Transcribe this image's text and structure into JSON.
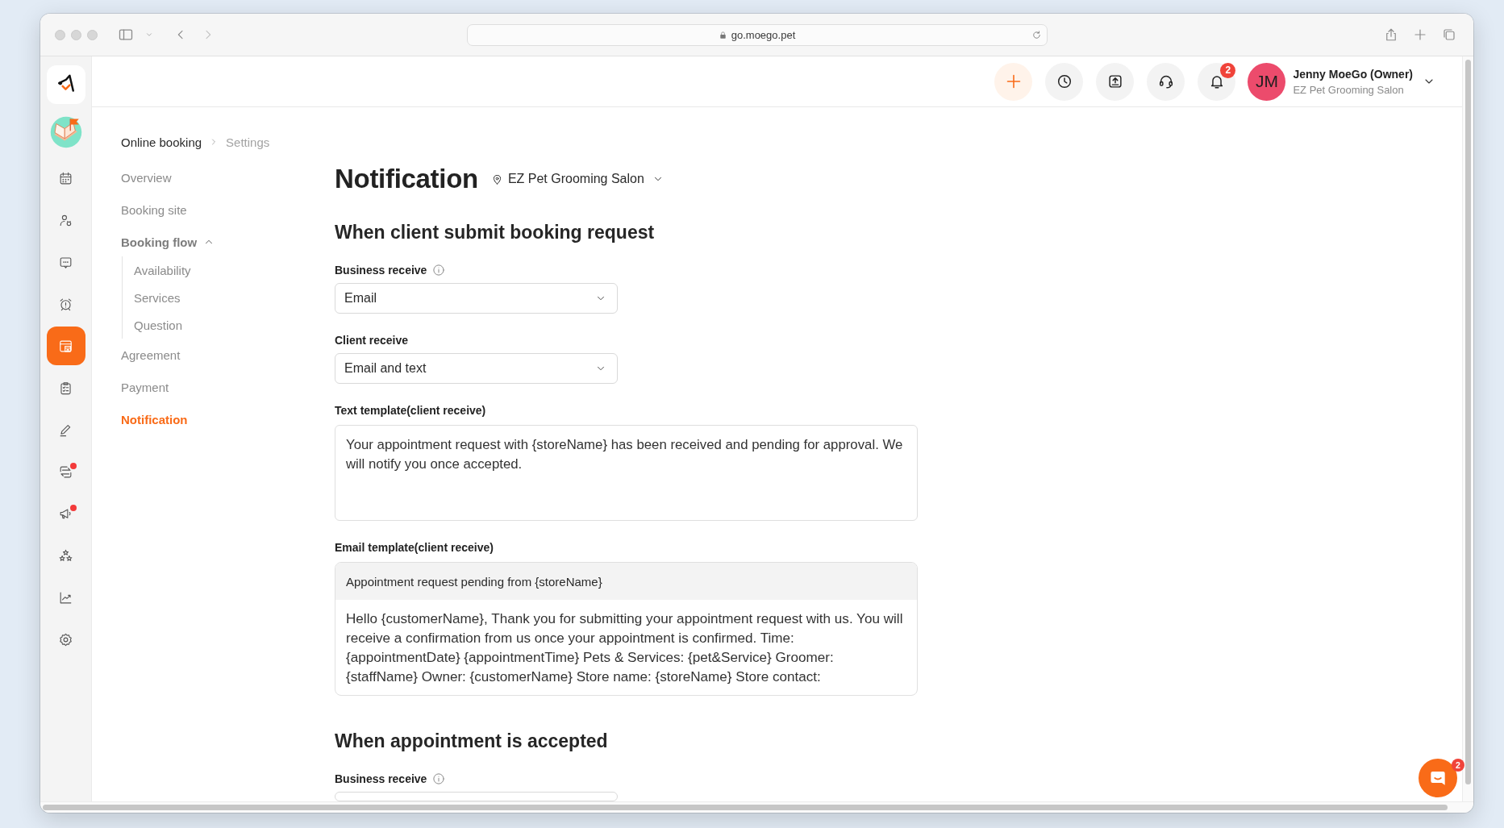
{
  "browser": {
    "url": "go.moego.pet"
  },
  "rail": {
    "items": [
      {
        "selected": false,
        "alert": false
      },
      {
        "selected": false,
        "alert": false
      },
      {
        "selected": false,
        "alert": false
      },
      {
        "selected": false,
        "alert": false
      },
      {
        "selected": true,
        "alert": false
      },
      {
        "selected": false,
        "alert": false
      },
      {
        "selected": false,
        "alert": false
      },
      {
        "selected": false,
        "alert": true
      },
      {
        "selected": false,
        "alert": true
      },
      {
        "selected": false,
        "alert": false
      },
      {
        "selected": false,
        "alert": false
      },
      {
        "selected": false,
        "alert": false
      }
    ]
  },
  "header": {
    "notifications": "2",
    "user": {
      "initials": "JM",
      "name": "Jenny MoeGo (Owner)",
      "business": "EZ Pet Grooming Salon"
    }
  },
  "breadcrumb": [
    "Online booking",
    "Settings"
  ],
  "nav": {
    "items": [
      {
        "label": "Overview",
        "selected": false
      },
      {
        "label": "Booking site",
        "selected": false
      },
      {
        "label": "Booking flow",
        "selected": false,
        "expanded": true,
        "children": [
          {
            "label": "Availability",
            "selected": false
          },
          {
            "label": "Services",
            "selected": false
          },
          {
            "label": "Question",
            "selected": false
          }
        ]
      },
      {
        "label": "Agreement",
        "selected": false
      },
      {
        "label": "Payment",
        "selected": false
      },
      {
        "label": "Notification",
        "selected": true
      }
    ]
  },
  "page": {
    "title": "Notification",
    "location": "EZ Pet Grooming Salon"
  },
  "sections": [
    {
      "heading": "When client submit booking request",
      "fields": [
        {
          "kind": "select",
          "label": "Business receive",
          "info": true,
          "value": "Email"
        },
        {
          "kind": "select",
          "label": "Client receive",
          "info": false,
          "value": "Email and text"
        },
        {
          "kind": "textarea",
          "label": "Text template(client receive)",
          "value": "Your appointment request with {storeName} has been received and pending for approval. We will notify you once accepted."
        },
        {
          "kind": "email",
          "label": "Email template(client receive)",
          "subject": "Appointment request pending from {storeName}",
          "body": "Hello {customerName}, Thank you for submitting your appointment request with us. You will receive a confirmation from us once your appointment is confirmed. Time: {appointmentDate} {appointmentTime} Pets & Services: {pet&Service} Groomer: {staffName} Owner: {customerName} Store name: {storeName} Store contact:"
        }
      ]
    },
    {
      "heading": "When appointment is accepted",
      "fields": [
        {
          "kind": "select",
          "label": "Business receive",
          "info": true
        }
      ]
    }
  ],
  "chat_launcher": {
    "badge": "2"
  }
}
